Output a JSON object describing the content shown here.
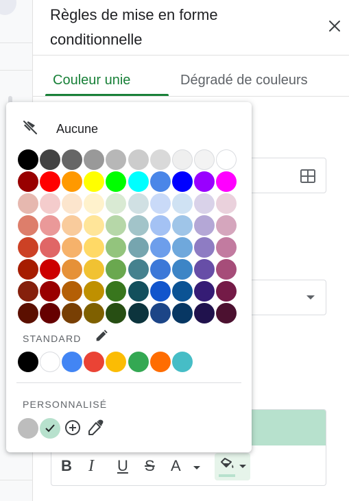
{
  "panel": {
    "title": "Règles de mise en forme conditionnelle",
    "close_icon": "close-icon",
    "tabs": [
      {
        "label": "Couleur unie",
        "active": true
      },
      {
        "label": "Dégradé de couleurs",
        "active": false
      }
    ],
    "range_icon": "grid-icon",
    "select_icon": "dropdown-arrow-icon",
    "preview_color": "#b7e1cd",
    "format_toolbar": {
      "bold": "B",
      "italic": "I",
      "underline": "U",
      "strikethrough": "S",
      "text_color": "A",
      "fill_color_icon": "fill-color-icon"
    }
  },
  "picker": {
    "none_label": "Aucune",
    "none_icon": "no-fill-icon",
    "palette": [
      [
        "#000000",
        "#434343",
        "#666666",
        "#999999",
        "#b7b7b7",
        "#cccccc",
        "#d9d9d9",
        "#efefef",
        "#f3f3f3",
        "#ffffff"
      ],
      [
        "#980000",
        "#ff0000",
        "#ff9900",
        "#ffff00",
        "#00ff00",
        "#00ffff",
        "#4a86e8",
        "#0000ff",
        "#9900ff",
        "#ff00ff"
      ],
      [
        "#e6b8af",
        "#f4cccc",
        "#fce5cd",
        "#fff2cc",
        "#d9ead3",
        "#d0e0e3",
        "#c9daf8",
        "#cfe2f3",
        "#d9d2e9",
        "#ead1dc"
      ],
      [
        "#dd7e6b",
        "#ea9999",
        "#f9cb9c",
        "#ffe599",
        "#b6d7a8",
        "#a2c4c9",
        "#a4c2f4",
        "#9fc5e8",
        "#b4a7d6",
        "#d5a6bd"
      ],
      [
        "#cc4125",
        "#e06666",
        "#f6b26b",
        "#ffd966",
        "#93c47d",
        "#76a5af",
        "#6d9eeb",
        "#6fa8dc",
        "#8e7cc3",
        "#c27ba0"
      ],
      [
        "#a61c00",
        "#cc0000",
        "#e69138",
        "#f1c232",
        "#6aa84f",
        "#45818e",
        "#3c78d8",
        "#3d85c6",
        "#674ea7",
        "#a64d79"
      ],
      [
        "#85200c",
        "#990000",
        "#b45f06",
        "#bf9000",
        "#38761d",
        "#134f5c",
        "#1155cc",
        "#0b5394",
        "#351c75",
        "#741b47"
      ],
      [
        "#5b0f00",
        "#660000",
        "#783f04",
        "#7f6000",
        "#274e13",
        "#0c343d",
        "#1c4587",
        "#073763",
        "#20124d",
        "#4c1130"
      ]
    ],
    "standard_label": "STANDARD",
    "standard_edit_icon": "edit-pencil-icon",
    "standard_colors": [
      "#000000",
      "#ffffff",
      "#4285f4",
      "#ea4335",
      "#fbbc04",
      "#34a853",
      "#ff6d01",
      "#46bdc6"
    ],
    "custom_label": "PERSONNALISÉ",
    "custom_colors": [
      "#bdbdbd",
      "#b7e1cd"
    ],
    "custom_selected": "#b7e1cd",
    "add_custom_icon": "add-circle-icon",
    "eyedropper_icon": "eyedropper-icon"
  }
}
